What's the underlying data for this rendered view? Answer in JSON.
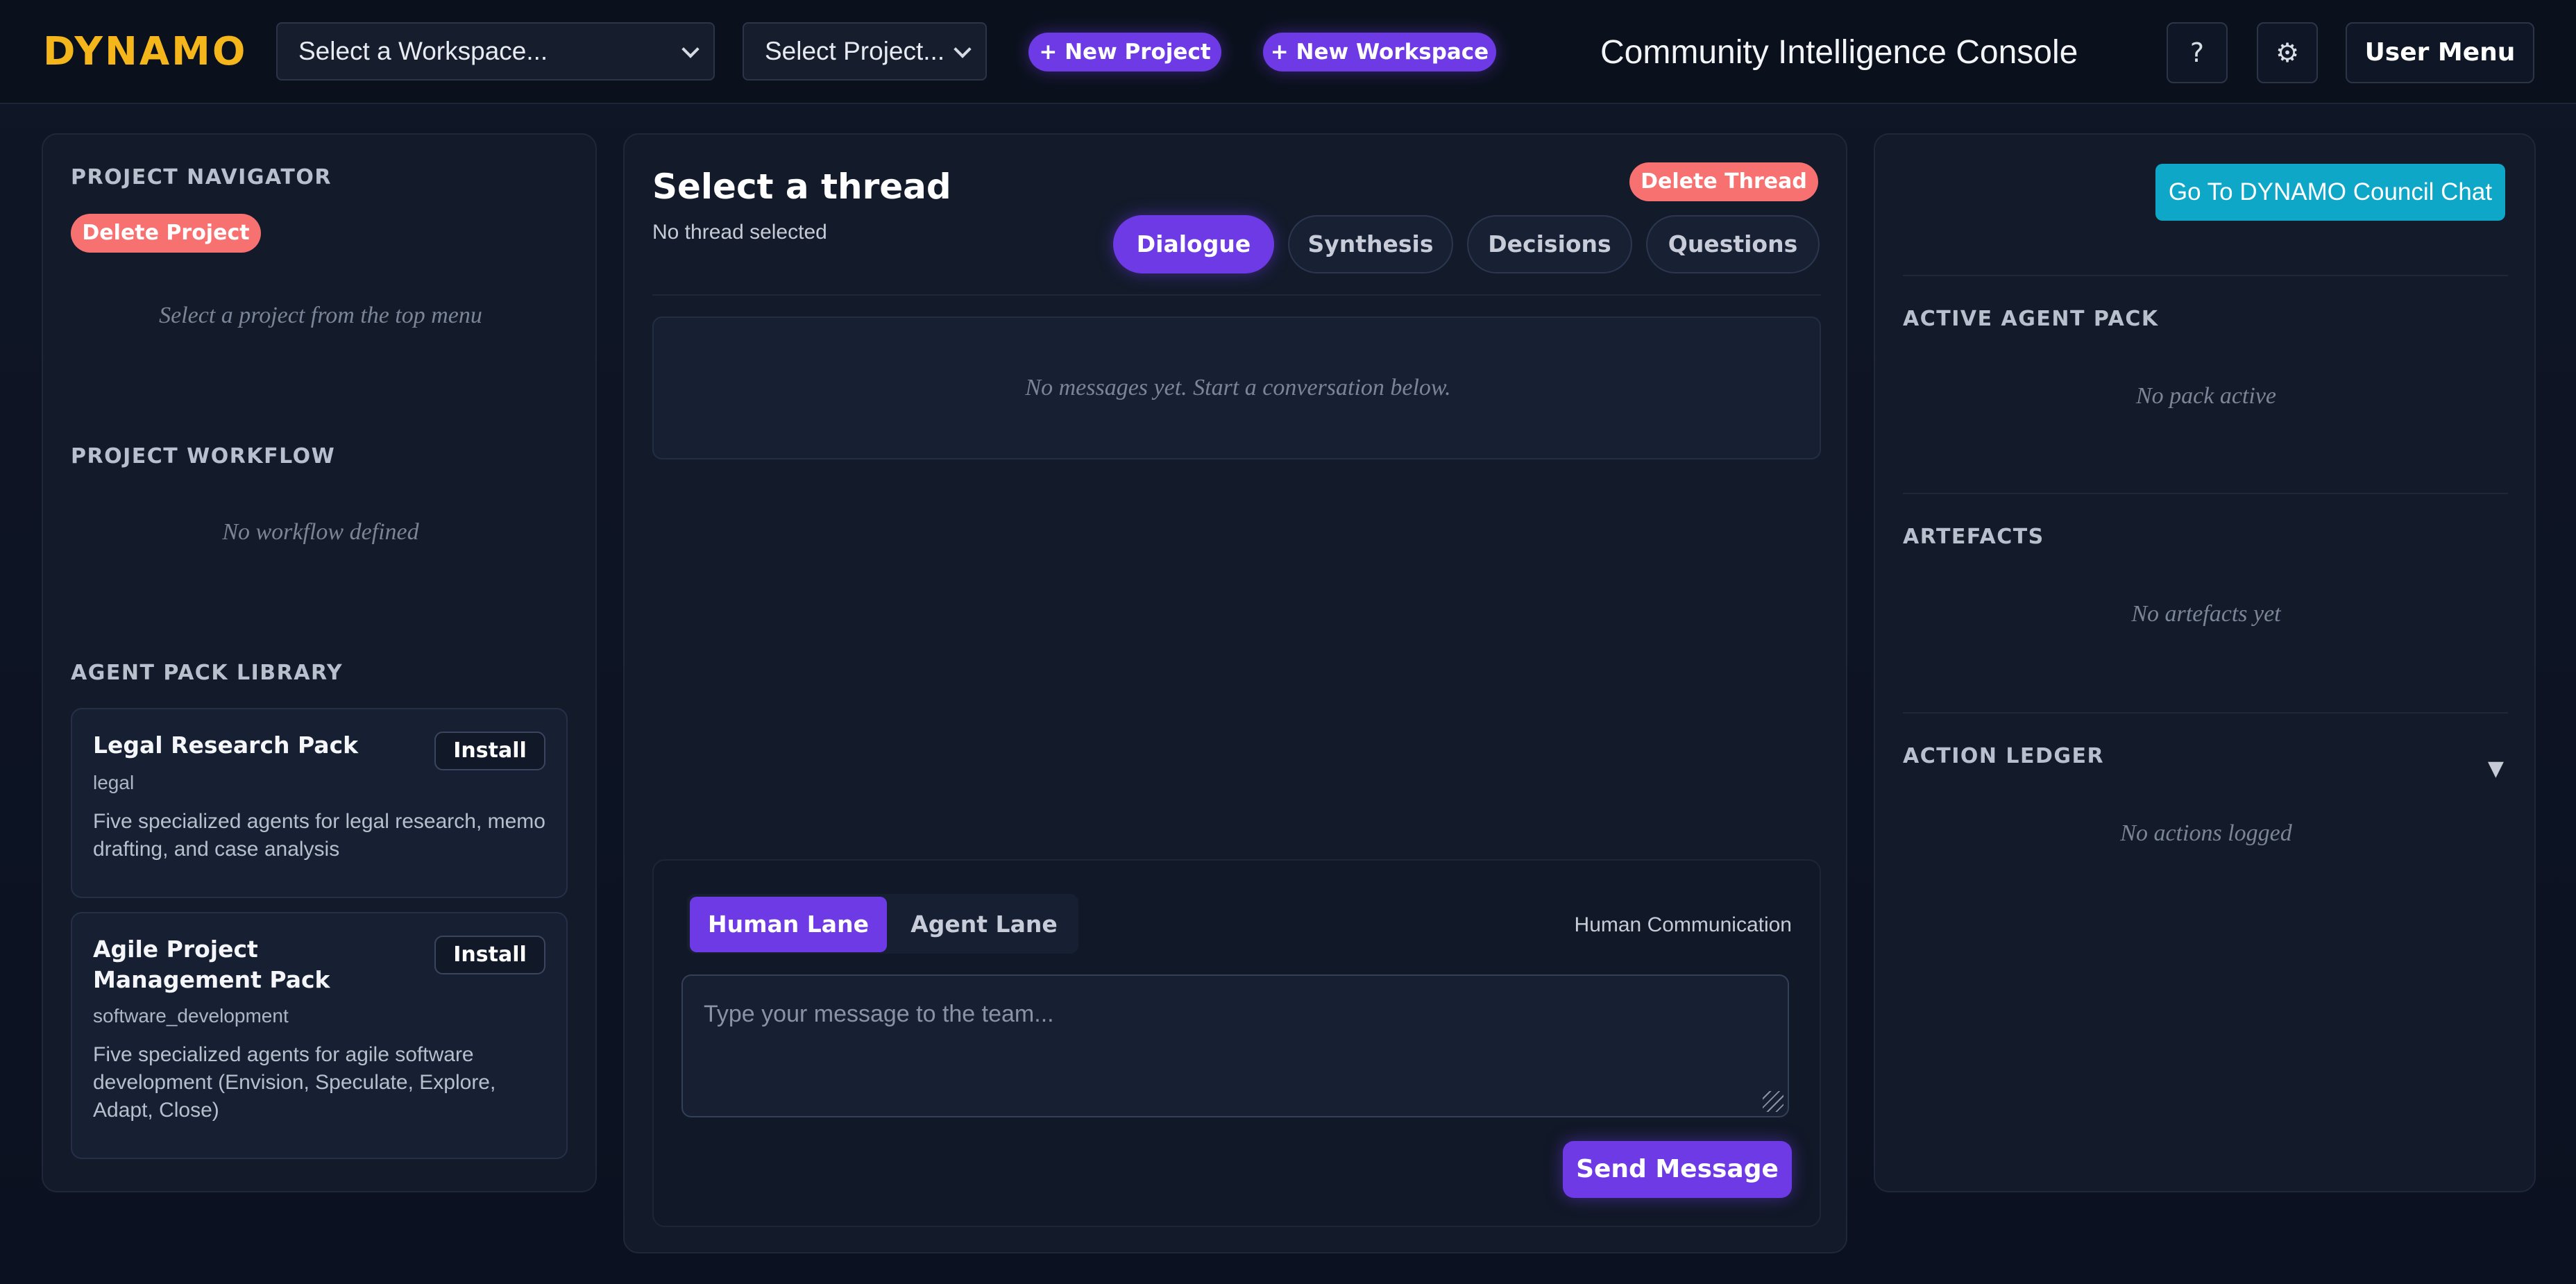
{
  "header": {
    "logo": "DYNAMO",
    "workspace_select": "Select a Workspace...",
    "project_select": "Select Project...",
    "new_project": "+ New Project",
    "new_workspace": "+ New Workspace",
    "console_title": "Community Intelligence Console",
    "help": "?",
    "settings": "⚙",
    "user_menu": "User Menu"
  },
  "left": {
    "navigator_title": "PROJECT NAVIGATOR",
    "delete_project": "Delete Project",
    "navigator_empty": "Select a project from the top menu",
    "workflow_title": "PROJECT WORKFLOW",
    "workflow_empty": "No workflow defined",
    "library_title": "AGENT PACK LIBRARY",
    "packs": [
      {
        "name": "Legal Research Pack",
        "category": "legal",
        "description": "Five specialized agents for legal research, memo drafting, and case analysis",
        "install": "Install"
      },
      {
        "name": "Agile Project Management Pack",
        "category": "software_development",
        "description": "Five specialized agents for agile software development (Envision, Speculate, Explore, Adapt, Close)",
        "install": "Install"
      }
    ]
  },
  "main": {
    "thread_title": "Select a thread",
    "thread_sub": "No thread selected",
    "delete_thread": "Delete Thread",
    "tabs": [
      "Dialogue",
      "Synthesis",
      "Decisions",
      "Questions"
    ],
    "empty_messages": "No messages yet. Start a conversation below.",
    "lanes": [
      "Human Lane",
      "Agent Lane"
    ],
    "lane_label": "Human Communication",
    "message_placeholder": "Type your message to the team...",
    "send": "Send Message"
  },
  "right": {
    "council_button": "Go To DYNAMO Council Chat",
    "agent_pack_title": "ACTIVE AGENT PACK",
    "agent_pack_empty": "No pack active",
    "artefacts_title": "ARTEFACTS",
    "artefacts_empty": "No artefacts yet",
    "ledger_title": "ACTION LEDGER",
    "ledger_caret": "▼",
    "ledger_empty": "No actions logged"
  },
  "colors": {
    "accent": "#6d3ae6",
    "logo": "#f5b61c",
    "danger": "#f87171",
    "info": "#0fa7c7",
    "background": "#0d1320"
  }
}
